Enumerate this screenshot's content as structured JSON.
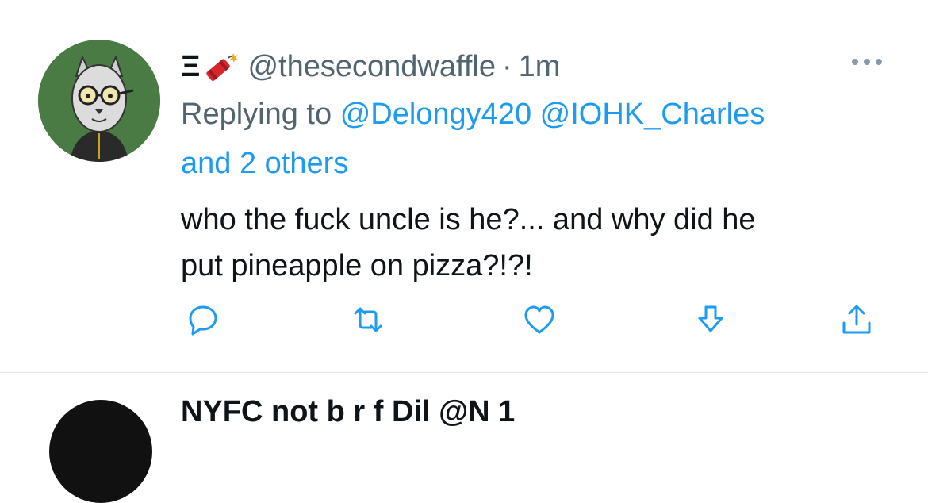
{
  "tweet": {
    "display_name": "Ξ",
    "display_name_emoji": "dynamite-icon",
    "handle": "@thesecondwaffle",
    "separator": "·",
    "time": "1m",
    "replying_prefix": "Replying to",
    "mention_1": "@Delongy420",
    "mention_2": "@IOHK_Charles",
    "others": "and 2 others",
    "text_line_1": "who the fuck uncle is he?... and why did he",
    "text_line_2": "put pineapple on pizza?!?!",
    "actions": [
      "comment-icon",
      "retweet-icon",
      "like-icon",
      "download-icon",
      "share-icon"
    ]
  },
  "next_tweet": {
    "partial_text": "NYFC  not  b     r   f  Dil   @N  1"
  },
  "colors": {
    "accent": "#1d9bf0",
    "muted": "#536471",
    "text": "#0f1419",
    "avatar_bg": "#4b7b45"
  }
}
